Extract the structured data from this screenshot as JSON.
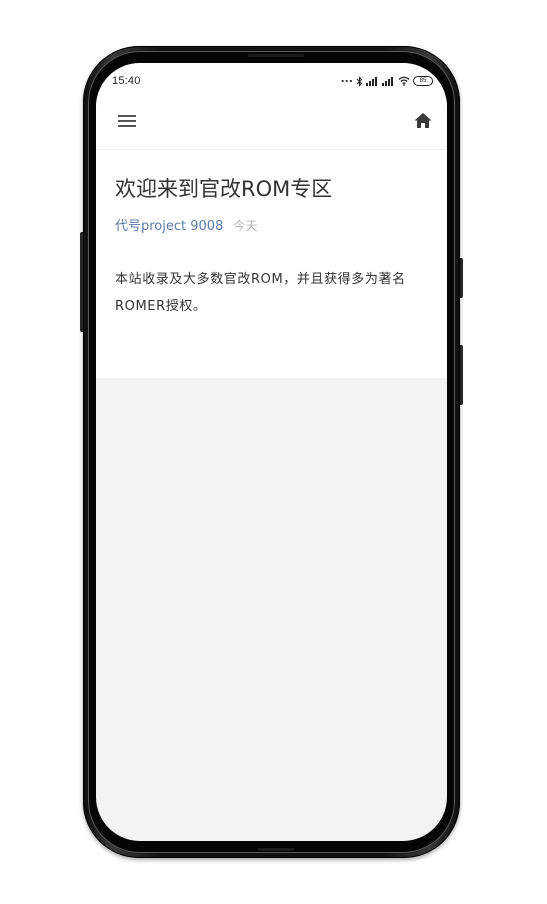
{
  "status_bar": {
    "time": "15:40",
    "dots": "...",
    "battery_level": "85"
  },
  "toolbar": {
    "menu_icon": "hamburger-menu-icon",
    "home_icon": "home-icon"
  },
  "article": {
    "title": "欢迎来到官改ROM专区",
    "author": "代号project 9008",
    "date": "今天",
    "body": "本站收录及大多数官改ROM，并且获得多为著名ROMER授权。"
  },
  "colors": {
    "author_link": "#5b7ba9",
    "title_text": "#333333",
    "date_text": "#b5b5b5",
    "screen_background": "#f3f3f3"
  }
}
